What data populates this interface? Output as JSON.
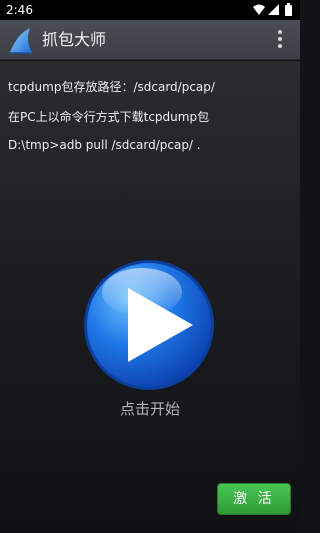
{
  "status_bar": {
    "time": "2:46"
  },
  "app_bar": {
    "title": "抓包大师"
  },
  "main": {
    "lines": [
      "tcpdump包存放路径：/sdcard/pcap/",
      "在PC上以命令行方式下载tcpdump包",
      "D:\\tmp>adb pull /sdcard/pcap/ ."
    ],
    "start_label": "点击开始",
    "activate_label": "激 活"
  },
  "icons": {
    "status": [
      "wifi-icon",
      "signal-icon",
      "battery-icon"
    ],
    "app_logo": "shark-fin-logo-icon",
    "menu": "overflow-menu-icon",
    "play": "play-icon"
  },
  "colors": {
    "activate_green": "#3cab45",
    "play_blue": "#1f78e8"
  }
}
